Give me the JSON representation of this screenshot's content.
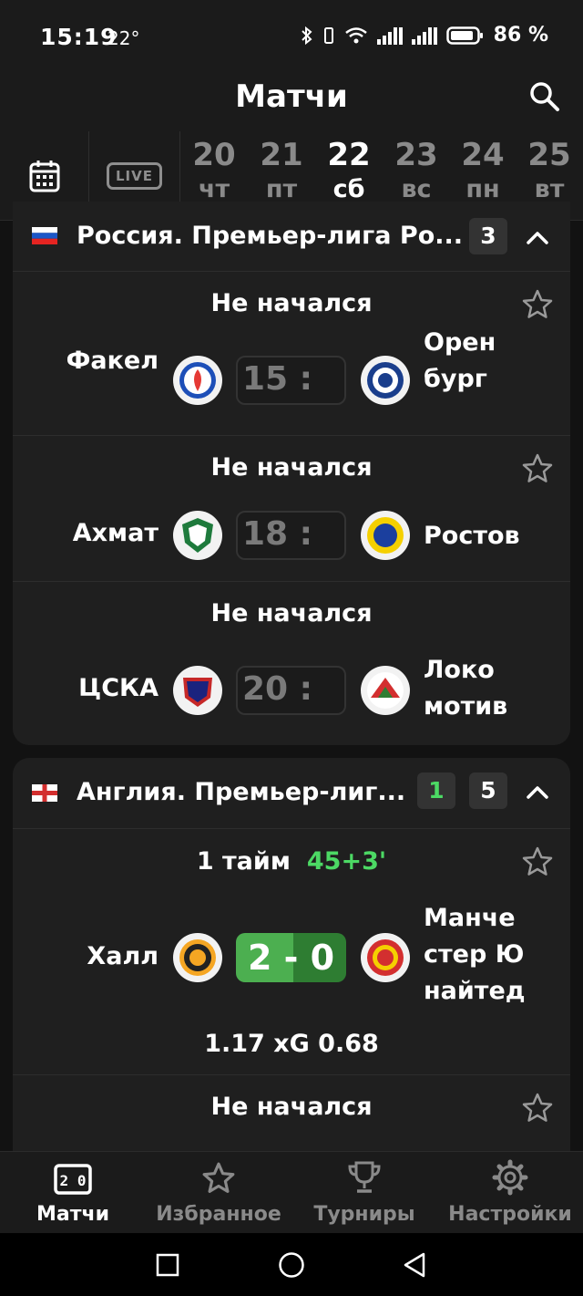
{
  "status_bar": {
    "time": "15:19",
    "temperature": "22°",
    "battery": "86 %"
  },
  "header": {
    "title": "Матчи"
  },
  "date_bar": {
    "live_label": "LIVE",
    "days": [
      {
        "num": "20",
        "dow": "чт",
        "active": false
      },
      {
        "num": "21",
        "dow": "пт",
        "active": false
      },
      {
        "num": "22",
        "dow": "сб",
        "active": true
      },
      {
        "num": "23",
        "dow": "вс",
        "active": false
      },
      {
        "num": "24",
        "dow": "пн",
        "active": false
      },
      {
        "num": "25",
        "dow": "вт",
        "active": false
      }
    ]
  },
  "leagues": [
    {
      "name": "Россия. Премьер-лига Ро...",
      "flag": "russia-flag",
      "count": "3",
      "matches": [
        {
          "status": "Не начался",
          "home": "Факел",
          "away": "Орен бург",
          "away_lines": [
            "Орен",
            "бург"
          ],
          "score": "15 :"
        },
        {
          "status": "Не начался",
          "home": "Ахмат",
          "away": "Ростов",
          "score": "18 :"
        },
        {
          "status": "Не начался",
          "home": "ЦСКА",
          "away": "Локо мотив",
          "away_lines": [
            "Локо",
            "мотив"
          ],
          "score": "20 :"
        }
      ]
    },
    {
      "name": "Англия. Премьер-лиг...",
      "flag": "england-flag",
      "live_count": "1",
      "count": "5",
      "matches": [
        {
          "status": "1 тайм",
          "minute": "45+3'",
          "home": "Халл",
          "away": "Манче стер Ю найтед",
          "away_lines": [
            "Манче",
            "стер Ю",
            "найтед"
          ],
          "score": "2 - 0",
          "xg": "1.17 xG 0.68"
        },
        {
          "status": "Не начался"
        }
      ]
    }
  ],
  "bottom_nav": [
    {
      "label": "Матчи",
      "icon": "scoreboard-icon",
      "active": true
    },
    {
      "label": "Избранное",
      "icon": "star-icon",
      "active": false
    },
    {
      "label": "Турниры",
      "icon": "trophy-icon",
      "active": false
    },
    {
      "label": "Настройки",
      "icon": "gear-icon",
      "active": false
    }
  ],
  "colors": {
    "live_green": "#4cd964",
    "score_green": "#4caf50",
    "background": "#121212",
    "card": "#1f1f1f"
  }
}
